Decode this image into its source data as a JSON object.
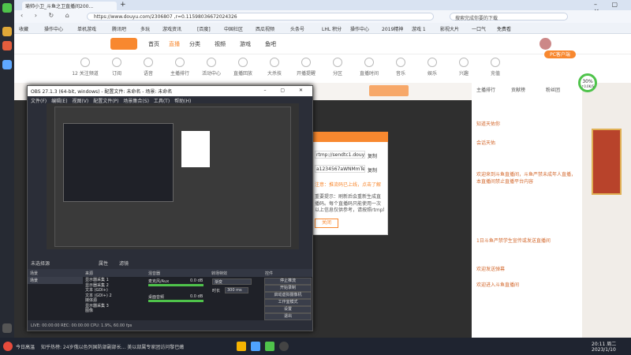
{
  "browser": {
    "tab_title": "瑜帅小卫_斗鱼之卫直播间200...",
    "url": "https://www.douyu.com/2306807 ,r=0.11598036672024326",
    "search_placeholder": "搜索完成你要的下载",
    "bookmarks": [
      "收藏",
      "操作中心",
      "单机游戏",
      "腾讯吧",
      "多玩",
      "游戏资讯",
      "[百度]",
      "中国社区",
      "西瓜视频",
      "头条号",
      "LHL 积分",
      "操作中心",
      "2019精神",
      "游戏 1",
      "影视大片",
      "一口气",
      "免费看"
    ]
  },
  "site": {
    "nav": [
      "首页",
      "直播",
      "分类",
      "视频",
      "游戏",
      "鱼吧"
    ],
    "categories": [
      "12 关注频道",
      "订阅",
      "语音",
      "主播排行",
      "活动中心",
      "直播回放",
      "大杀技",
      "开播提醒",
      "分区",
      "直播时间",
      "音乐",
      "娱乐",
      "兴趣",
      "充值"
    ],
    "pc_client": "PC客户端",
    "room_tabs": [
      "主播排行",
      "贡献榜",
      "粉丝团"
    ],
    "chat_messages": [
      "知道天佑你",
      "会话天佑",
      "欢迎来到斗鱼直播间，斗鱼严禁未成年人直播，本直播间禁止直播平台内容",
      "1日斗鱼严禁学生宣传或发送直播间",
      "欢迎发送弹幕",
      "欢迎进入斗鱼直播间"
    ],
    "badge_percent": "30%",
    "badge_sub": "↑0.0K/S"
  },
  "obs": {
    "title": "OBS 27.1.3 (64-bit, windows) - 配置文件: 未命名 - 场景: 未命名",
    "menu": [
      "文件(F)",
      "编辑(E)",
      "视图(V)",
      "配置文件(P)",
      "场景集合(S)",
      "工具(T)",
      "帮助(H)"
    ],
    "no_source": "未选择源",
    "props_btn": "属性",
    "filters_btn": "滤镜",
    "docks": [
      "场景",
      "来源",
      "混音器",
      "转场特效",
      "控件"
    ],
    "scene_item": "场景",
    "sources": [
      "显示器采集 1",
      "显示器采集 2",
      "文本 (GDI+)",
      "文本 (GDI+) 2",
      "媒体源",
      "显示器采集 3",
      "图像"
    ],
    "mixer": [
      {
        "name": "桌面音频",
        "db": "0.0 dB"
      },
      {
        "name": "麦克风/Aux",
        "db": "0.0 dB"
      }
    ],
    "transition": "渐变",
    "duration_label": "时长",
    "duration_value": "300 ms",
    "controls": [
      "停止推流",
      "开始录制",
      "启动虚拟摄像机",
      "工作室模式",
      "设置",
      "退出"
    ],
    "status": "LIVE: 00:00:00    REC: 00:00:00    CPU: 1.9%, 60.00 fps"
  },
  "dialog": {
    "server": "rtmp://sendtc1.douyu.com/live",
    "copy1": "复制",
    "key": "a1234567aWNMmTeoSecretlv*********",
    "copy2": "复制",
    "hint1": "注意：推流码已上线，点击了解",
    "hint2": "重要提示：刷新后会重新生成直播码。每个直播码只能使用一次",
    "hint3": "以上信息仅供参考，请按照rtmp地址实际复制。",
    "close_btn": "关闭"
  },
  "taskbar": {
    "temp": "今日高温",
    "news": "知乎热榜: 24岁俄以色列国防部副部长... 美以部属专家团访问黎巴嫩",
    "time": "20:11 周二",
    "date": "2023/1/10"
  },
  "colors": {
    "accent": "#f8882f",
    "obs_bg": "#2b2e38",
    "live_green": "#4fc34b"
  }
}
